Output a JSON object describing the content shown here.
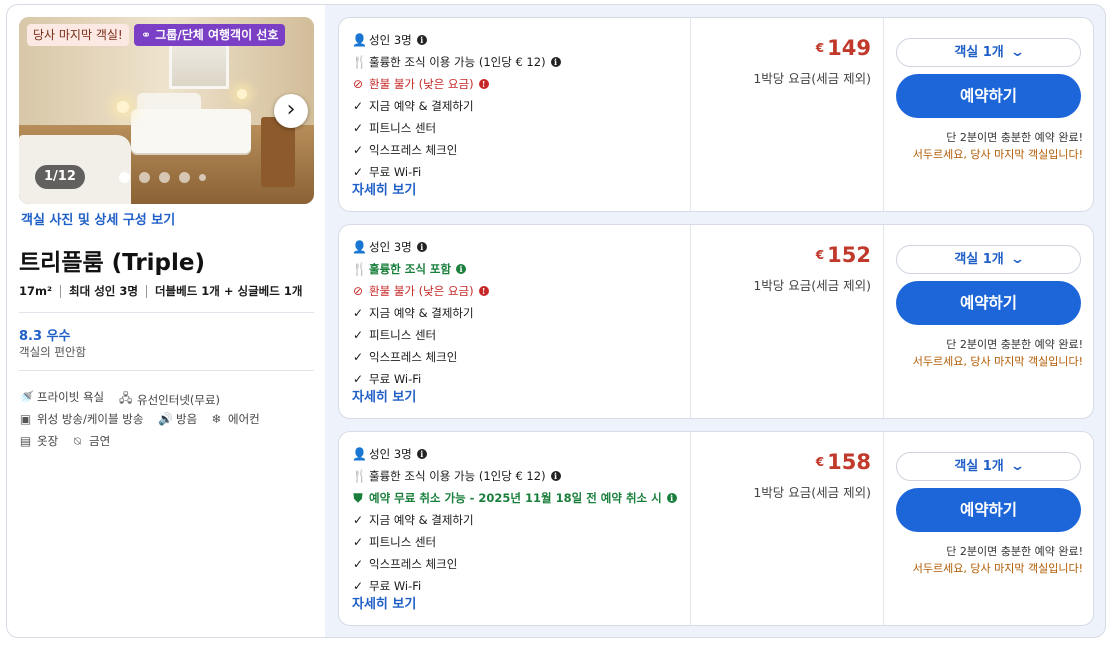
{
  "room": {
    "badge_last": "당사 마지막 객실!",
    "badge_group": "그룹/단체 여행객이 선호",
    "photo_counter": "1/12",
    "photos_link": "객실 사진 및 상세 구성 보기",
    "title": "트리플룸 (Triple)",
    "size": "17m²",
    "max_guests": "최대 성인 3명",
    "beds": "더블베드 1개 + 싱글베드 1개",
    "rating": "8.3 우수",
    "rating_sub": "객실의 편안함",
    "amenities": [
      {
        "icon": "shower-icon",
        "label": "프라이빗 욕실"
      },
      {
        "icon": "network-icon",
        "label": "유선인터넷(무료)"
      },
      {
        "icon": "tv-icon",
        "label": "위성 방송/케이블 방송"
      },
      {
        "icon": "speaker-icon",
        "label": "방음"
      },
      {
        "icon": "snowflake-icon",
        "label": "에어컨"
      },
      {
        "icon": "wardrobe-icon",
        "label": "옷장"
      },
      {
        "icon": "no-smoking-icon",
        "label": "금연"
      }
    ]
  },
  "offers": [
    {
      "guests": "성인 3명",
      "meal": "훌륭한 조식 이용 가능 (1인당 € 12)",
      "policy": "환불 불가 (낮은 요금)",
      "features": [
        "지금 예약 & 결제하기",
        "피트니스 센터",
        "익스프레스 체크인",
        "무료 Wi-Fi"
      ],
      "details_link": "자세히 보기",
      "currency": "€",
      "price": "149",
      "price_note": "1박당 요금(세금 제외)",
      "room_select": "객실 1개",
      "book_label": "예약하기",
      "note1": "단 2분이면 충분한 예약 완료!",
      "note2": "서두르세요, 당사 마지막 객실입니다!"
    },
    {
      "guests": "성인 3명",
      "meal": "훌륭한 조식 포함",
      "policy": "환불 불가 (낮은 요금)",
      "features": [
        "지금 예약 & 결제하기",
        "피트니스 센터",
        "익스프레스 체크인",
        "무료 Wi-Fi"
      ],
      "details_link": "자세히 보기",
      "currency": "€",
      "price": "152",
      "price_note": "1박당 요금(세금 제외)",
      "room_select": "객실 1개",
      "book_label": "예약하기",
      "note1": "단 2분이면 충분한 예약 완료!",
      "note2": "서두르세요, 당사 마지막 객실입니다!"
    },
    {
      "guests": "성인 3명",
      "meal": "훌륭한 조식 이용 가능 (1인당 € 12)",
      "policy": "예약 무료 취소 가능 - 2025년 11월 18일 전 예약 취소 시",
      "features": [
        "지금 예약 & 결제하기",
        "피트니스 센터",
        "익스프레스 체크인",
        "무료 Wi-Fi"
      ],
      "details_link": "자세히 보기",
      "currency": "€",
      "price": "158",
      "price_note": "1박당 요금(세금 제외)",
      "room_select": "객실 1개",
      "book_label": "예약하기",
      "note1": "단 2분이면 충분한 예약 완료!",
      "note2": "서두르세요, 당사 마지막 객실입니다!"
    }
  ],
  "colors": {
    "accent": "#1d66d9",
    "price": "#c0392b",
    "warning": "#c62828",
    "success": "#1a7f3c",
    "urgency": "#b15a00",
    "badge_group": "#7a3fc4"
  }
}
